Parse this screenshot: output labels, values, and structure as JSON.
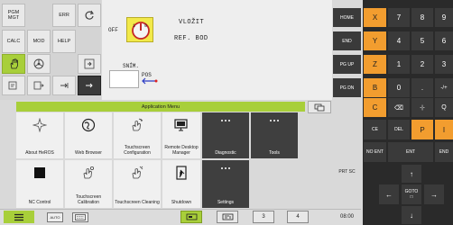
{
  "left_keys": {
    "pgm_mgt": "PGM MGT",
    "err": "ERR",
    "calc": "CALC",
    "mod": "MOD",
    "help": "HELP"
  },
  "machine": {
    "off_label": "OFF",
    "sel_left": "1",
    "sel_right": "0",
    "line1": "VLOŽIT",
    "line2": "REF. BOD",
    "snim": "SNÍM.",
    "pos": "POS"
  },
  "app_menu": {
    "title": "Application Menu",
    "tiles": [
      {
        "label": "About HeROS",
        "icon": "sparkle-icon"
      },
      {
        "label": "Web Browser",
        "icon": "globe-icon"
      },
      {
        "label": "Touchscreen Configuration",
        "icon": "touch-config-icon"
      },
      {
        "label": "Remote Desktop Manager",
        "icon": "remote-desktop-icon"
      },
      {
        "label": "Diagnostic",
        "icon": "ellipsis-icon"
      },
      {
        "label": "Tools",
        "icon": "ellipsis-icon"
      },
      {
        "label": "NC Control",
        "icon": "stop-square-icon"
      },
      {
        "label": "Touchscreen Calibration",
        "icon": "touch-calibrate-icon"
      },
      {
        "label": "Touchscreen Cleaning",
        "icon": "touch-clean-icon"
      },
      {
        "label": "Shutdown",
        "icon": "exit-door-icon"
      },
      {
        "label": "Settings",
        "icon": "ellipsis-icon"
      }
    ]
  },
  "nav": {
    "home": "HOME",
    "end": "END",
    "pgup": "PG UP",
    "pgdn": "PG DN",
    "prtsc": "PRT SC"
  },
  "numpad": {
    "rows": [
      [
        "X",
        "7",
        "8",
        "9"
      ],
      [
        "Y",
        "4",
        "5",
        "6"
      ],
      [
        "Z",
        "1",
        "2",
        "3"
      ],
      [
        "B",
        "0",
        ".",
        "-/+"
      ],
      [
        "C",
        "⌫",
        "-|-",
        "Q"
      ]
    ],
    "ce": "CE",
    "del": "DEL",
    "p": "P",
    "i": "I",
    "no_ent": "NO ENT",
    "ent": "ENT",
    "end": "END",
    "goto": "GOTO"
  },
  "taskbar": {
    "auto": "AUTO",
    "ws3": "3",
    "ws4": "4",
    "time": "08:00"
  },
  "colors": {
    "accent_green": "#a8cf3a",
    "orange_key": "#f29d2f",
    "dark_key": "#3a3a3a"
  }
}
